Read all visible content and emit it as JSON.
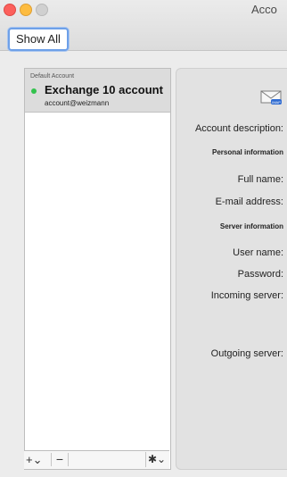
{
  "window": {
    "title": "Acco"
  },
  "toolbar": {
    "show_all_label": "Show All"
  },
  "account_list": {
    "default_label": "Default Account",
    "account_name": "Exchange 10 account",
    "account_email": "account@weizmann",
    "status_color": "#33c24d"
  },
  "list_controls": {
    "add_label": "+⌄",
    "remove_label": "−",
    "gear_label": "✱⌄"
  },
  "detail": {
    "badge": "IMAP",
    "account_description_label": "Account description:",
    "personal_section": "Personal information",
    "full_name_label": "Full name:",
    "email_label": "E-mail address:",
    "server_section": "Server information",
    "user_name_label": "User name:",
    "password_label": "Password:",
    "incoming_label": "Incoming server:",
    "outgoing_label": "Outgoing server:"
  }
}
